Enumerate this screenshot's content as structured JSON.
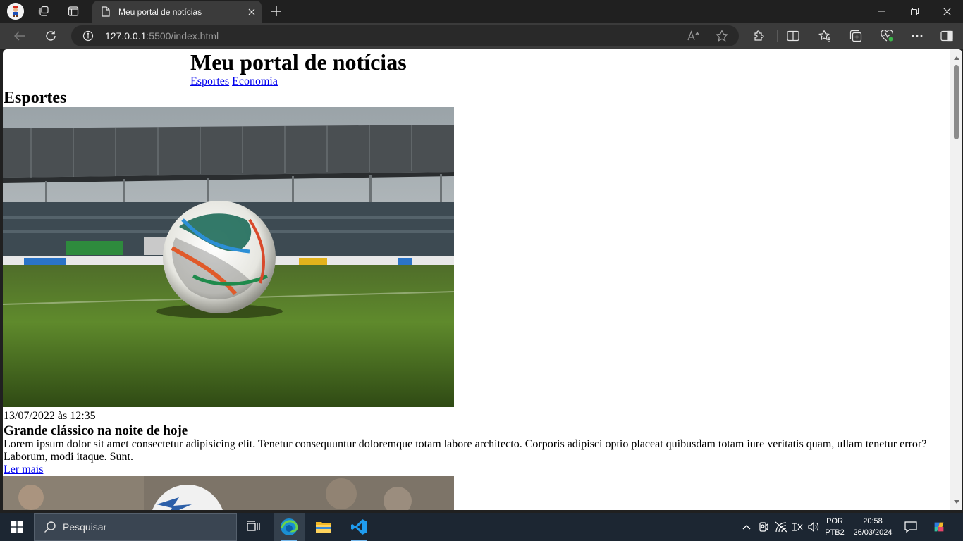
{
  "browser": {
    "tab_title": "Meu portal de notícias",
    "url_host": "127.0.0.1",
    "url_rest": ":5500/index.html"
  },
  "page": {
    "site_title": "Meu portal de notícias",
    "nav": [
      "Esportes",
      "Economia"
    ],
    "section_title": "Esportes",
    "news": {
      "date": "13/07/2022 às 12:35",
      "title": "Grande clássico na noite de hoje",
      "text": "Lorem ipsum dolor sit amet consectetur adipisicing elit. Tenetur consequuntur doloremque totam labore architecto. Corporis adipisci optio placeat quibusdam totam iure veritatis quam, ullam tenetur error? Laborum, modi itaque. Sunt.",
      "link": "Ler mais"
    }
  },
  "taskbar": {
    "search_label": "Pesquisar",
    "lang_line1": "POR",
    "lang_line2": "PTB2",
    "time": "20:58",
    "date": "26/03/2024"
  },
  "colors": {
    "link": "#0000ee",
    "taskbar": "#1c2632",
    "browser_chrome": "#202020",
    "toolbar": "#3b3b3b"
  }
}
